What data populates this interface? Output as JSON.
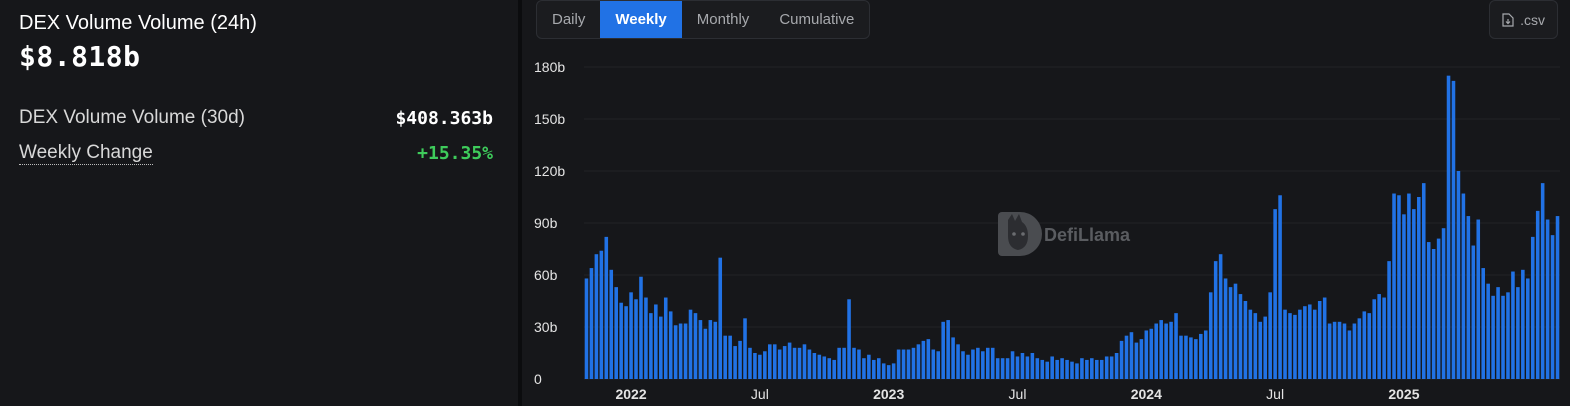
{
  "summary": {
    "volume_24h_label": "DEX Volume Volume (24h)",
    "volume_24h_value": "$8.818b",
    "volume_30d_label": "DEX Volume Volume (30d)",
    "volume_30d_value": "$408.363b",
    "weekly_change_label": "Weekly Change",
    "weekly_change_value": "+15.35%",
    "positive_color": "#3ecb5b"
  },
  "tabs": [
    {
      "label": "Daily",
      "active": false
    },
    {
      "label": "Weekly",
      "active": true
    },
    {
      "label": "Monthly",
      "active": false
    },
    {
      "label": "Cumulative",
      "active": false
    }
  ],
  "csv_label": ".csv",
  "watermark": "DefiLlama",
  "chart_data": {
    "type": "bar",
    "title": "",
    "xlabel": "",
    "ylabel": "",
    "ylim": [
      0,
      180
    ],
    "y_unit": "b",
    "y_ticks": [
      "0",
      "30b",
      "60b",
      "90b",
      "120b",
      "150b",
      "180b"
    ],
    "grid": true,
    "bar_color": "#2172e5",
    "x_ticks": [
      {
        "label": "2022",
        "index": 9,
        "major": true
      },
      {
        "label": "Jul",
        "index": 35,
        "major": false
      },
      {
        "label": "2023",
        "index": 61,
        "major": true
      },
      {
        "label": "Jul",
        "index": 87,
        "major": false
      },
      {
        "label": "2024",
        "index": 113,
        "major": true
      },
      {
        "label": "Jul",
        "index": 139,
        "major": false
      },
      {
        "label": "2025",
        "index": 165,
        "major": true
      }
    ],
    "values": [
      58,
      64,
      72,
      74,
      82,
      63,
      53,
      44,
      42,
      50,
      46,
      59,
      47,
      38,
      43,
      36,
      47,
      39,
      31,
      32,
      32,
      40,
      38,
      34,
      29,
      34,
      33,
      70,
      25,
      25,
      19,
      22,
      35,
      18,
      15,
      14,
      16,
      20,
      20,
      17,
      19,
      21,
      18,
      18,
      20,
      17,
      15,
      14,
      13,
      12,
      11,
      18,
      18,
      46,
      18,
      17,
      12,
      14,
      11,
      12,
      9,
      8,
      9,
      17,
      17,
      17,
      18,
      20,
      22,
      23,
      17,
      16,
      33,
      34,
      24,
      20,
      16,
      14,
      17,
      18,
      16,
      18,
      18,
      12,
      12,
      12,
      16,
      13,
      15,
      13,
      15,
      12,
      11,
      10,
      13,
      11,
      12,
      11,
      10,
      9,
      12,
      11,
      12,
      11,
      11,
      13,
      13,
      15,
      22,
      25,
      27,
      21,
      23,
      28,
      29,
      32,
      34,
      32,
      33,
      38,
      25,
      25,
      24,
      23,
      26,
      28,
      50,
      68,
      72,
      58,
      53,
      55,
      49,
      45,
      40,
      38,
      33,
      36,
      50,
      98,
      106,
      40,
      38,
      37,
      40,
      42,
      43,
      40,
      45,
      47,
      32,
      33,
      33,
      32,
      28,
      32,
      35,
      39,
      38,
      46,
      49,
      47,
      68,
      107,
      106,
      95,
      107,
      98,
      105,
      113,
      79,
      75,
      81,
      87,
      175,
      172,
      120,
      107,
      94,
      77,
      92,
      64,
      55,
      48,
      53,
      48,
      50,
      62,
      53,
      63,
      58,
      82,
      97,
      113,
      92,
      83,
      94
    ]
  }
}
